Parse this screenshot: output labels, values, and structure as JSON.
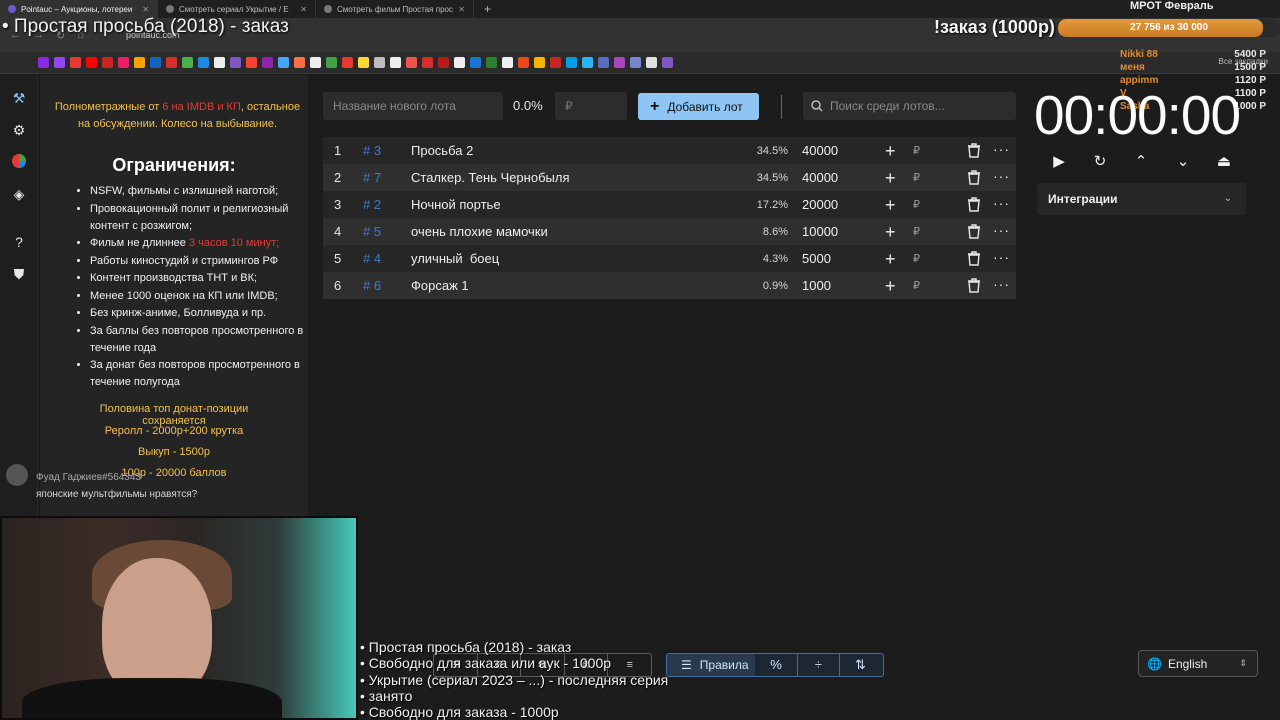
{
  "browser": {
    "tabs": [
      {
        "label": "Pointauc – Аукционы, лотереи",
        "active": true
      },
      {
        "label": "Смотреть сериал Укрытие / Е",
        "active": false
      },
      {
        "label": "Смотреть фильм Простая прос",
        "active": false
      }
    ],
    "url": "pointauc.com",
    "bookmarks_all_label": "Все закладки"
  },
  "overlay": {
    "title": "• Простая просьба (2018) - заказ",
    "order_label": "!заказ (1000р)",
    "mrot": {
      "label": "МРОТ Февраль",
      "progress_text": "27 756 из 30 000",
      "progress_fraction": 0.925
    },
    "donors": [
      {
        "name": "Nikki 88",
        "amount": "5400 Р"
      },
      {
        "name": "меня",
        "amount": "1500 Р"
      },
      {
        "name": "appimm",
        "amount": "1120 Р"
      },
      {
        "name": "V",
        "amount": "1100 Р"
      },
      {
        "name": "Sasha",
        "amount": "1000 Р"
      }
    ],
    "chat": {
      "user": "Фуад Гаджиев#564343",
      "message": "японские мультфильмы нравятся?"
    },
    "bottom_lines": [
      "• Простая просьба (2018) - заказ",
      "• Свободно для заказа или аук - 1000р",
      "• Укрытие (сериал 2023 – ...) - последняя серия",
      "• занято",
      "• Свободно для заказа - 1000р"
    ]
  },
  "rules": {
    "intro_a": "Полнометражные от ",
    "intro_red": "6 на IMDB и КП",
    "intro_b": ", остальное на обсуждении. Колесо на выбывание.",
    "heading": "Ограничения:",
    "items": [
      "NSFW, фильмы с излишней наготой;",
      "Провокационный полит и религиозный контент с розжигом;",
      "Работы киностудий и стримингов РФ",
      "Контент производства ТНТ и ВК;",
      "Менее 1000 оценок на КП или IMDB;",
      "Без кринж-аниме, Болливуда и пр.",
      "За баллы без повторов просмотренного в течение года",
      "За донат без повторов просмотренного в течение полугода"
    ],
    "length_item_a": "Фильм не длиннее ",
    "length_item_red": "3 часов 10 минут;",
    "extras": [
      "Половина топ донат-позиции сохраняется",
      "Реролл - 2000р+200 крутка",
      "Выкуп - 1500р",
      "100р - 20000 баллов"
    ]
  },
  "toolbar": {
    "new_lot_placeholder": "Название нового лота",
    "percent": "0.0%",
    "amount_placeholder": "₽",
    "add_lot_label": "Добавить лот",
    "search_placeholder": "Поиск среди лотов..."
  },
  "lots": [
    {
      "num": "1",
      "id": "# 3",
      "name": "Просьба 2",
      "percent": "34.5%",
      "amount": "40000"
    },
    {
      "num": "2",
      "id": "# 7",
      "name": "Сталкер. Тень Чернобыля",
      "percent": "34.5%",
      "amount": "40000"
    },
    {
      "num": "3",
      "id": "# 2",
      "name": "Ночной портье",
      "percent": "17.2%",
      "amount": "20000"
    },
    {
      "num": "4",
      "id": "# 5",
      "name": "очень плохие мамочки",
      "percent": "8.6%",
      "amount": "10000"
    },
    {
      "num": "5",
      "id": "# 4",
      "name": "уличный  боец",
      "percent": "4.3%",
      "amount": "5000"
    },
    {
      "num": "6",
      "id": "# 6",
      "name": "Форсаж 1",
      "percent": "0.9%",
      "amount": "1000"
    }
  ],
  "lot_currency": "₽",
  "timer": {
    "value": "00:00:00"
  },
  "integrations": {
    "label": "Интеграции"
  },
  "bottom_toolbar": {
    "rules_label": "Правила"
  },
  "language": {
    "selected": "English"
  },
  "colors": {
    "accent": "#8ec5f5",
    "lot_id": "#3b7cc9",
    "rules_highlight": "#f2c14e",
    "warning_red": "#e53935",
    "mrot_bar": "#e49a3c",
    "donor_name": "#e08a2e"
  }
}
